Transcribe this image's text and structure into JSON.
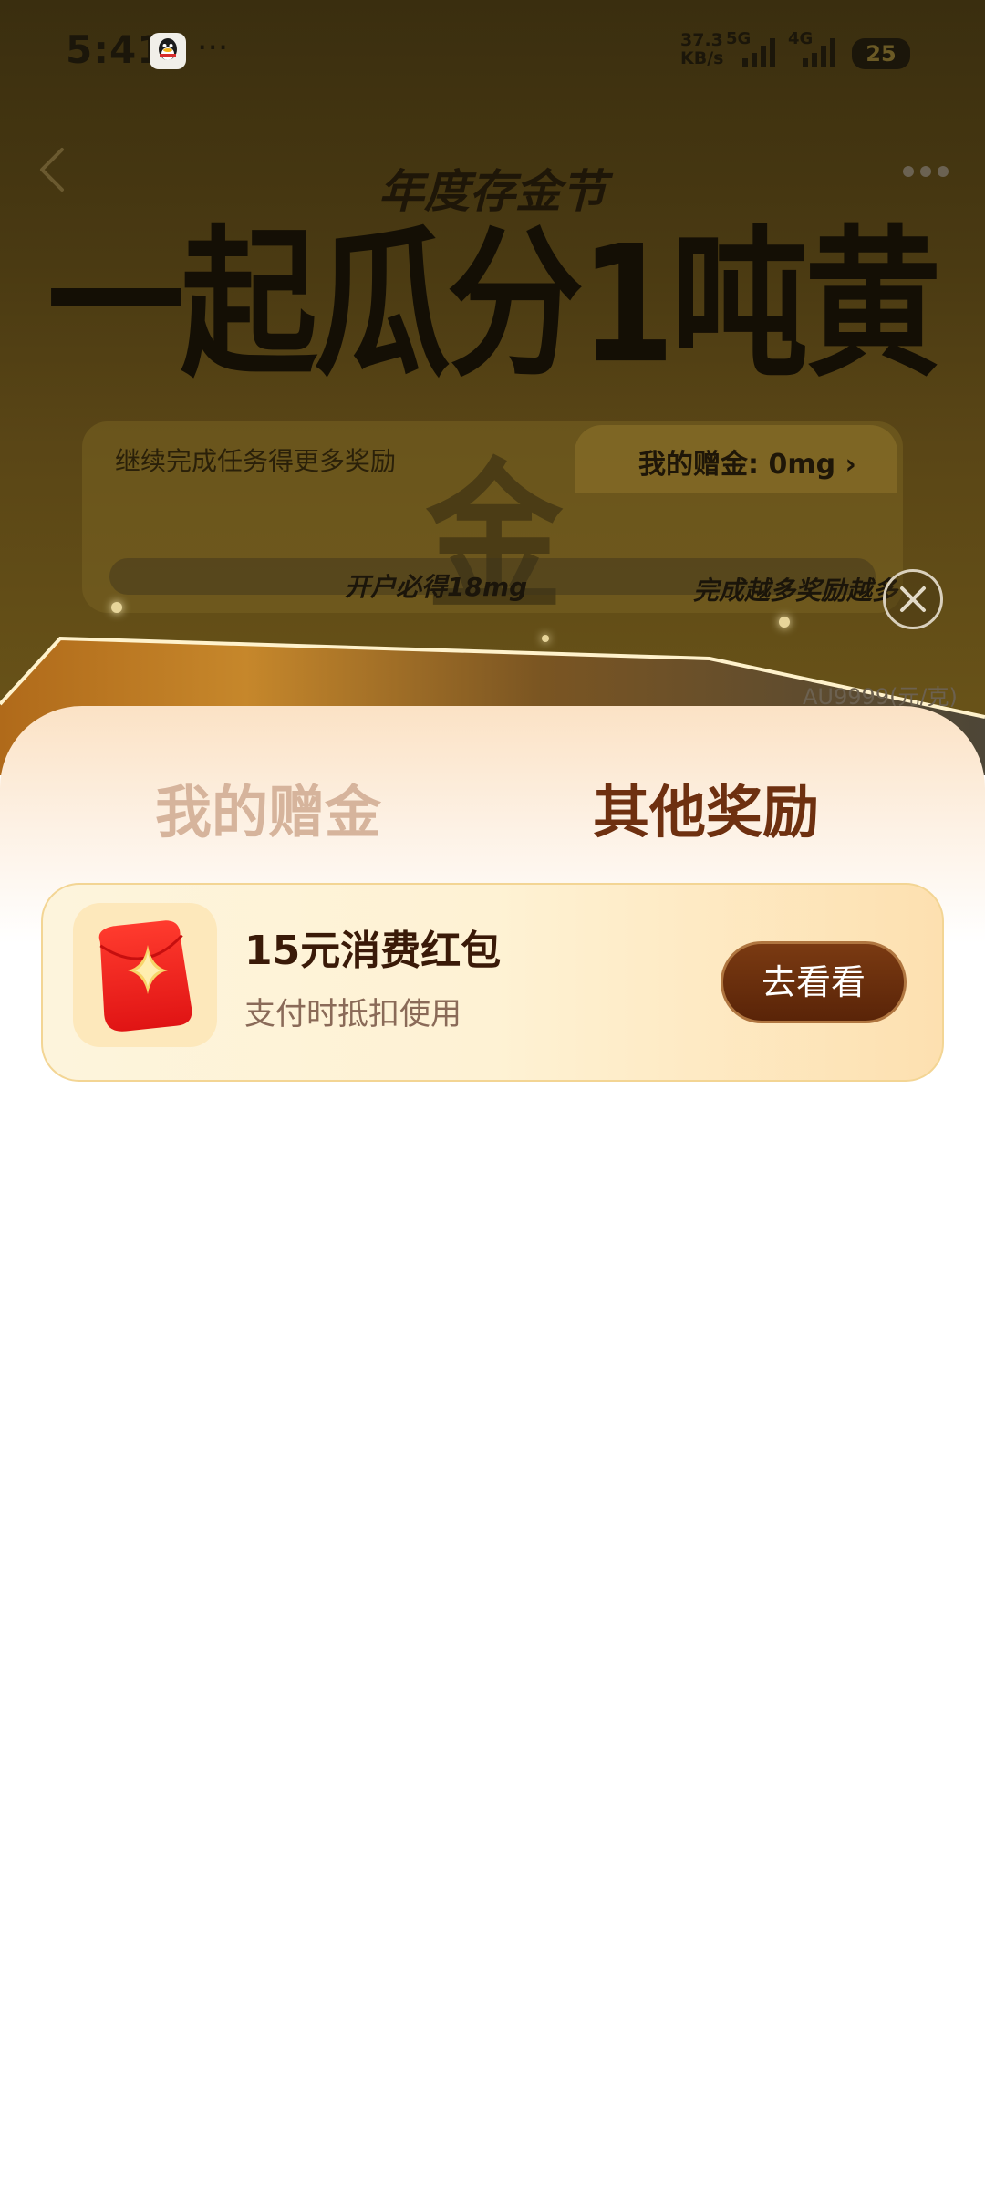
{
  "status_bar": {
    "time": "5:41",
    "more": "···",
    "net_speed_value": "37.3",
    "net_speed_unit": "KB/s",
    "net_5g": "5G",
    "net_4g": "4G",
    "battery": "25"
  },
  "header": {
    "festival_title": "年度存金节",
    "headline": "一起瓜分1吨黄金"
  },
  "task_card": {
    "hint": "继续完成任务得更多奖励",
    "my_gift": "我的赠金: 0mg ›",
    "milestone_1": "开户必得18mg",
    "milestone_2": "完成越多奖励越多"
  },
  "strip": {
    "price_hint": "AU9999(元/克)"
  },
  "sheet": {
    "tabs": [
      {
        "label": "我的赠金"
      },
      {
        "label": "其他奖励"
      }
    ],
    "active_tab": 1,
    "rewards": [
      {
        "title": "15元消费红包",
        "desc": "支付时抵扣使用",
        "button": "去看看",
        "icon": "red-envelope-icon"
      }
    ]
  },
  "colors": {
    "active_tab": "#6e3010",
    "inactive_tab": "#d6b49c",
    "button_bg": "#6a2e0c",
    "card_border": "#f3d594"
  }
}
